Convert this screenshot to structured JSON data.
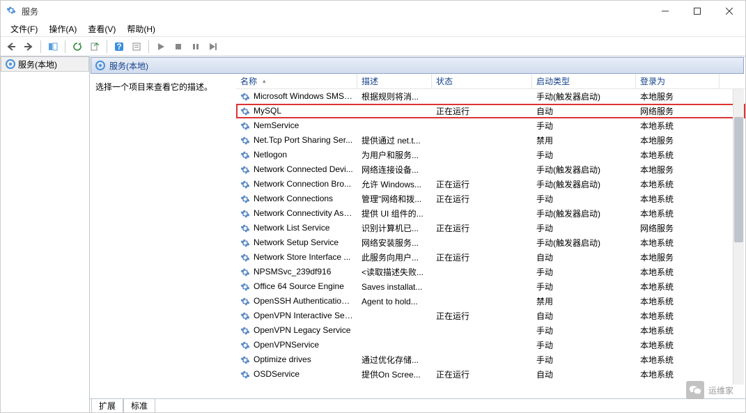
{
  "window": {
    "title": "服务"
  },
  "menu": {
    "file": "文件(F)",
    "action": "操作(A)",
    "view": "查看(V)",
    "help": "帮助(H)"
  },
  "tree": {
    "root": "服务(本地)"
  },
  "header": {
    "title": "服务(本地)"
  },
  "desc_pane": {
    "prompt": "选择一个项目来查看它的描述。"
  },
  "columns": {
    "name": "名称",
    "desc": "描述",
    "status": "状态",
    "start": "启动类型",
    "login": "登录为"
  },
  "tabs": {
    "extended": "扩展",
    "standard": "标准"
  },
  "watermark": {
    "text": "运维家"
  },
  "services": [
    {
      "name": "Microsoft Windows SMS ...",
      "desc": "根据规则将消...",
      "status": "",
      "start": "手动(触发器启动)",
      "login": "本地服务",
      "hl": false
    },
    {
      "name": "MySQL",
      "desc": "",
      "status": "正在运行",
      "start": "自动",
      "login": "网络服务",
      "hl": true
    },
    {
      "name": "NemService",
      "desc": "",
      "status": "",
      "start": "手动",
      "login": "本地系统",
      "hl": false
    },
    {
      "name": "Net.Tcp Port Sharing Ser...",
      "desc": "提供通过 net.t...",
      "status": "",
      "start": "禁用",
      "login": "本地服务",
      "hl": false
    },
    {
      "name": "Netlogon",
      "desc": "为用户和服务...",
      "status": "",
      "start": "手动",
      "login": "本地系统",
      "hl": false
    },
    {
      "name": "Network Connected Devi...",
      "desc": "网络连接设备...",
      "status": "",
      "start": "手动(触发器启动)",
      "login": "本地服务",
      "hl": false
    },
    {
      "name": "Network Connection Bro...",
      "desc": "允许 Windows...",
      "status": "正在运行",
      "start": "手动(触发器启动)",
      "login": "本地系统",
      "hl": false
    },
    {
      "name": "Network Connections",
      "desc": "管理\"网络和拨...",
      "status": "正在运行",
      "start": "手动",
      "login": "本地系统",
      "hl": false
    },
    {
      "name": "Network Connectivity Ass...",
      "desc": "提供 UI 组件的...",
      "status": "",
      "start": "手动(触发器启动)",
      "login": "本地系统",
      "hl": false
    },
    {
      "name": "Network List Service",
      "desc": "识别计算机已...",
      "status": "正在运行",
      "start": "手动",
      "login": "网络服务",
      "hl": false
    },
    {
      "name": "Network Setup Service",
      "desc": "网络安装服务...",
      "status": "",
      "start": "手动(触发器启动)",
      "login": "本地系统",
      "hl": false
    },
    {
      "name": "Network Store Interface ...",
      "desc": "此服务向用户...",
      "status": "正在运行",
      "start": "自动",
      "login": "本地服务",
      "hl": false
    },
    {
      "name": "NPSMSvc_239df916",
      "desc": "<读取描述失败...",
      "status": "",
      "start": "手动",
      "login": "本地系统",
      "hl": false
    },
    {
      "name": "Office 64 Source Engine",
      "desc": "Saves installat...",
      "status": "",
      "start": "手动",
      "login": "本地系统",
      "hl": false
    },
    {
      "name": "OpenSSH Authentication ...",
      "desc": "Agent to hold...",
      "status": "",
      "start": "禁用",
      "login": "本地系统",
      "hl": false
    },
    {
      "name": "OpenVPN Interactive Ser...",
      "desc": "",
      "status": "正在运行",
      "start": "自动",
      "login": "本地系统",
      "hl": false
    },
    {
      "name": "OpenVPN Legacy Service",
      "desc": "",
      "status": "",
      "start": "手动",
      "login": "本地系统",
      "hl": false
    },
    {
      "name": "OpenVPNService",
      "desc": "",
      "status": "",
      "start": "手动",
      "login": "本地系统",
      "hl": false
    },
    {
      "name": "Optimize drives",
      "desc": "通过优化存储...",
      "status": "",
      "start": "手动",
      "login": "本地系统",
      "hl": false
    },
    {
      "name": "OSDService",
      "desc": "提供On Scree...",
      "status": "正在运行",
      "start": "自动",
      "login": "本地系统",
      "hl": false
    }
  ]
}
